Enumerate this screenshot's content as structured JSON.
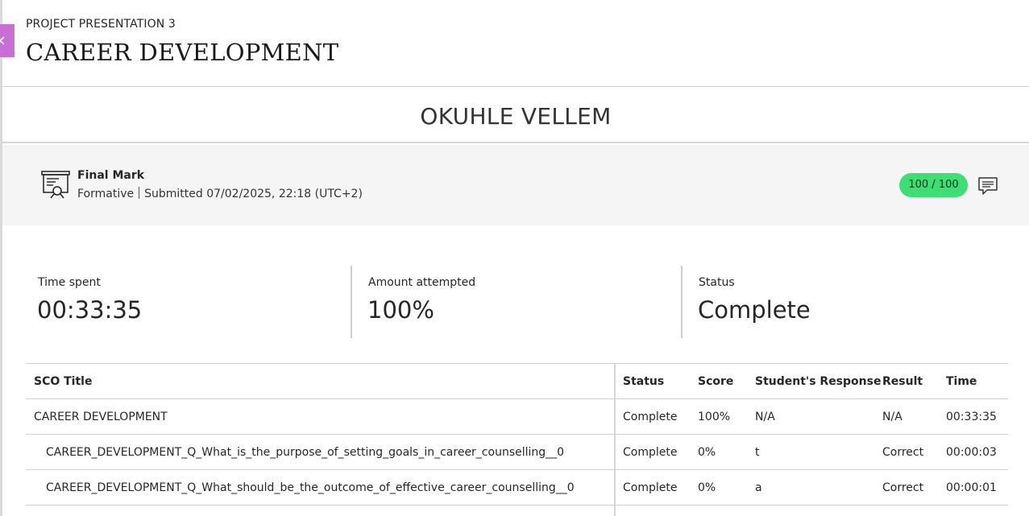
{
  "header": {
    "kicker": "PROJECT PRESENTATION 3",
    "title": "CAREER DEVELOPMENT",
    "close_icon": "chevron-left-icon"
  },
  "student": {
    "name": "OKUHLE VELLEM"
  },
  "final_mark": {
    "icon": "presentation-certificate-icon",
    "title": "Final Mark",
    "type": "Formative",
    "submitted": "Submitted 07/02/2025, 22:18 (UTC+2)",
    "score": "100 / 100",
    "score_color": "#3ddf74",
    "feedback_icon": "feedback-comment-icon"
  },
  "stats": [
    {
      "label": "Time spent",
      "value": "00:33:35"
    },
    {
      "label": "Amount attempted",
      "value": "100%"
    },
    {
      "label": "Status",
      "value": "Complete"
    }
  ],
  "table": {
    "headers": {
      "title": "SCO Title",
      "status": "Status",
      "score": "Score",
      "response": "Student's Response",
      "result": "Result",
      "time": "Time"
    },
    "rows": [
      {
        "title": "CAREER DEVELOPMENT",
        "status": "Complete",
        "score": "100%",
        "response": "N/A",
        "result": "N/A",
        "time": "00:33:35"
      },
      {
        "title": "CAREER_DEVELOPMENT_Q_What_is_the_purpose_of_setting_goals_in_career_counselling__0",
        "status": "Complete",
        "score": "0%",
        "response": "t",
        "result": "Correct",
        "time": "00:00:03"
      },
      {
        "title": "CAREER_DEVELOPMENT_Q_What_should_be_the_outcome_of_effective_career_counselling__0",
        "status": "Complete",
        "score": "0%",
        "response": "a",
        "result": "Correct",
        "time": "00:00:01"
      }
    ]
  }
}
